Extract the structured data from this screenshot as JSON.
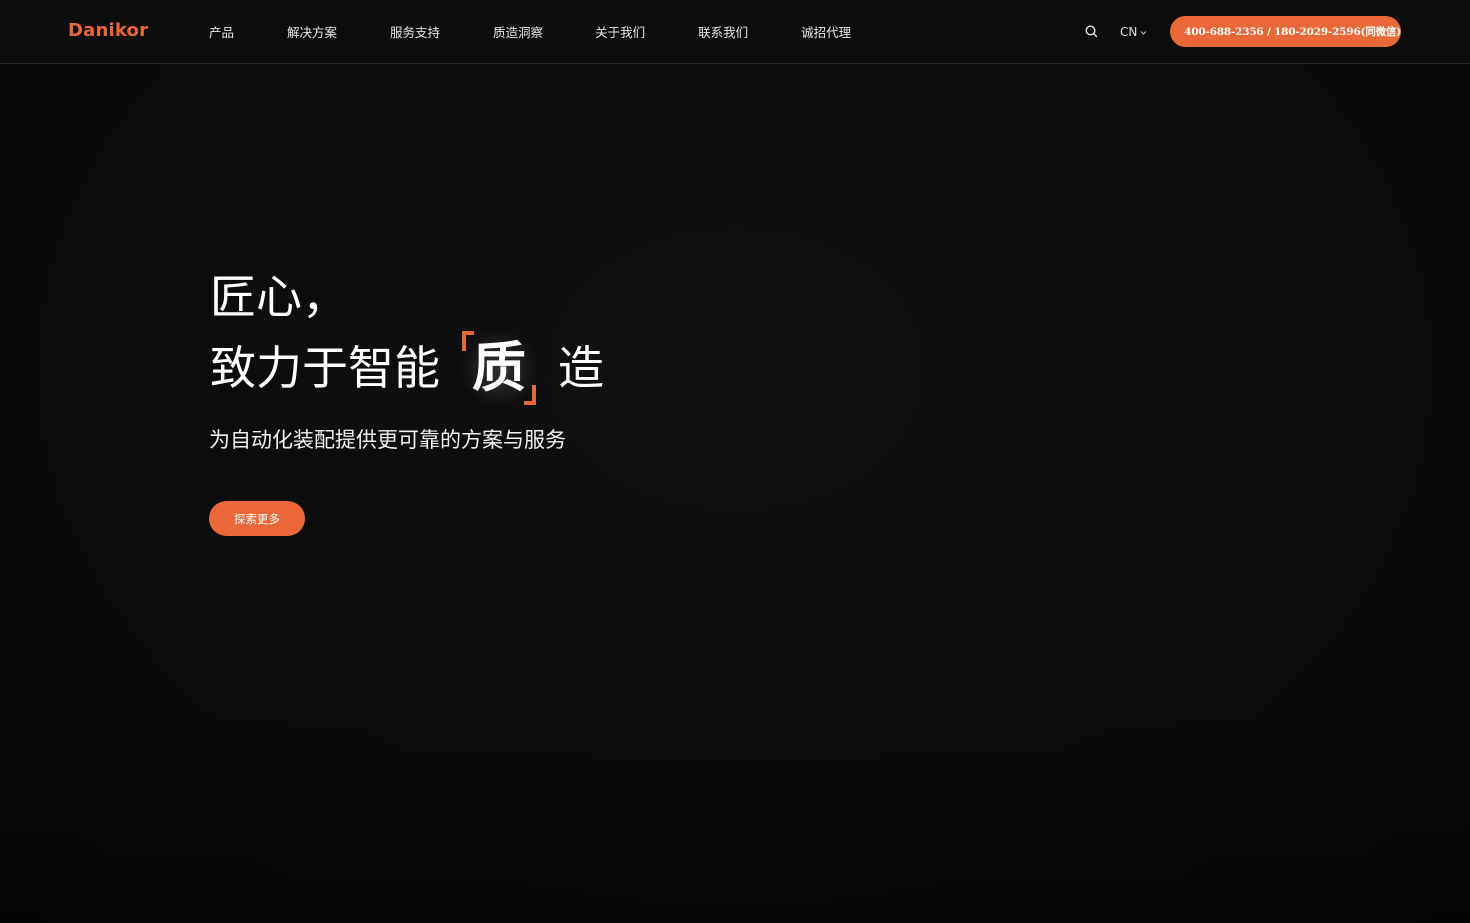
{
  "brand": {
    "logo_text": "Danikor",
    "accent_color": "#ea6737"
  },
  "nav": {
    "items": [
      {
        "label": "产品"
      },
      {
        "label": "解决方案"
      },
      {
        "label": "服务支持"
      },
      {
        "label": "质造洞察"
      },
      {
        "label": "关于我们"
      },
      {
        "label": "联系我们"
      },
      {
        "label": "诚招代理"
      }
    ]
  },
  "header": {
    "search_icon": "search-icon",
    "language": "CN",
    "language_icon": "chevron-down-icon",
    "phone_icon": "phone-icon",
    "phone_text": "400-688-2356 / 180-2029-2596(同微信)"
  },
  "hero": {
    "line1": "匠心，",
    "line2_prefix": "致力于智能",
    "line2_highlight": "质",
    "line2_suffix": "造",
    "subtitle": "为自动化装配提供更可靠的方案与服务",
    "cta_label": "探索更多"
  }
}
